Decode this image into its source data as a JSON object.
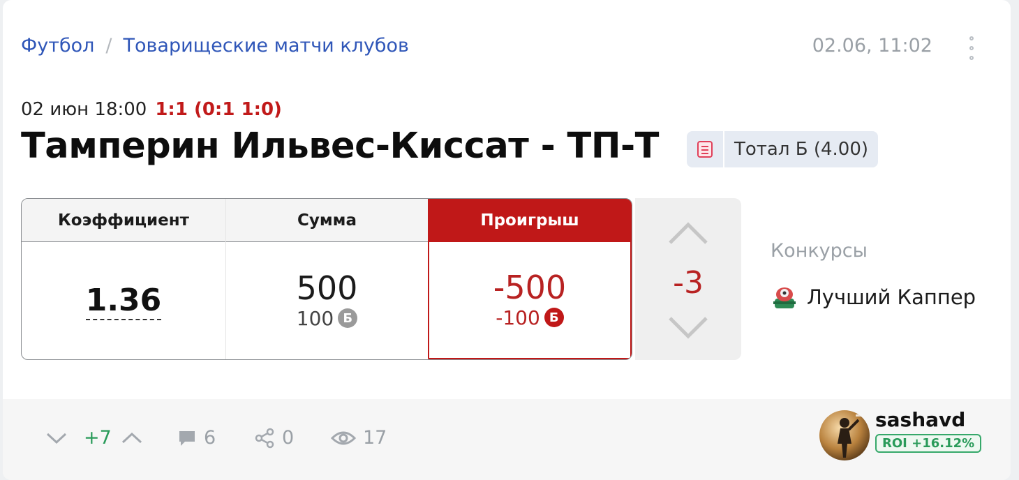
{
  "breadcrumb": {
    "sport": "Футбол",
    "separator": "/",
    "tournament": "Товарищеские матчи клубов"
  },
  "posted_at": "02.06, 11:02",
  "match": {
    "datetime": "02 июн 18:00",
    "score": "1:1 (0:1 1:0)",
    "title": "Тамперин Ильвес-Киссат - ТП-Т"
  },
  "bet": {
    "type_icon": "list-icon",
    "label": "Тотал Б (4.00)"
  },
  "stats": {
    "coef_header": "Коэффициент",
    "sum_header": "Сумма",
    "result_header": "Проигрыш",
    "coef": "1.36",
    "sum": "500",
    "sum_points": "100",
    "points_badge": "Б",
    "result": "-500",
    "result_points": "-100"
  },
  "vote": {
    "count": "-3"
  },
  "contests": {
    "label": "Конкурсы",
    "item": "Лучший Каппер"
  },
  "footer": {
    "rating": "+7",
    "comments": "6",
    "shares": "0",
    "views": "17"
  },
  "author": {
    "name": "sashavd",
    "roi": "ROI +16.12%"
  },
  "colors": {
    "link": "#2f56b8",
    "loss": "#c01818",
    "positive": "#2a9b5a",
    "muted": "#9aa0a6"
  }
}
